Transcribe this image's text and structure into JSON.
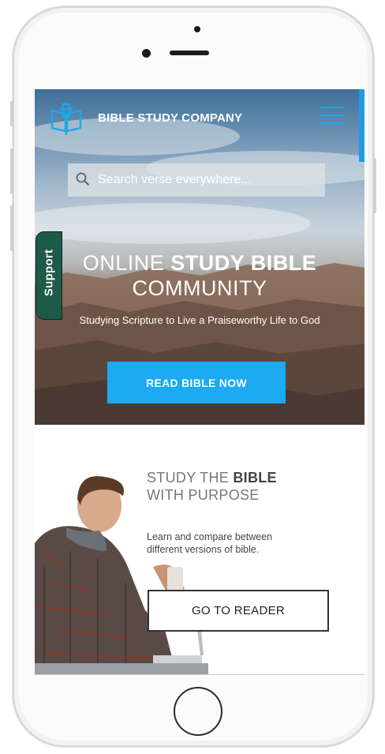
{
  "header": {
    "brand": "BIBLE STUDY COMPANY",
    "logo_icon": "open-bible-icon",
    "menu_icon": "hamburger-menu-icon",
    "accent_color": "#1caaf0"
  },
  "search": {
    "placeholder": "Search verse everywhere...",
    "value": "",
    "icon": "search-icon"
  },
  "support_tab": {
    "label": "Support",
    "color": "#1d5a47"
  },
  "hero": {
    "headline_light_1": "ONLINE ",
    "headline_bold": "STUDY BIBLE",
    "headline_light_2": "COMMUNITY",
    "subtitle": "Studying Scripture to Live a Praiseworthy Life to God",
    "cta_label": "READ BIBLE NOW"
  },
  "section": {
    "title_line1_light": "STUDY THE ",
    "title_line1_bold": "BIBLE",
    "title_line2": "WITH PURPOSE",
    "body": "Learn and compare between different versions of bible.",
    "button_label": "GO TO READER"
  }
}
